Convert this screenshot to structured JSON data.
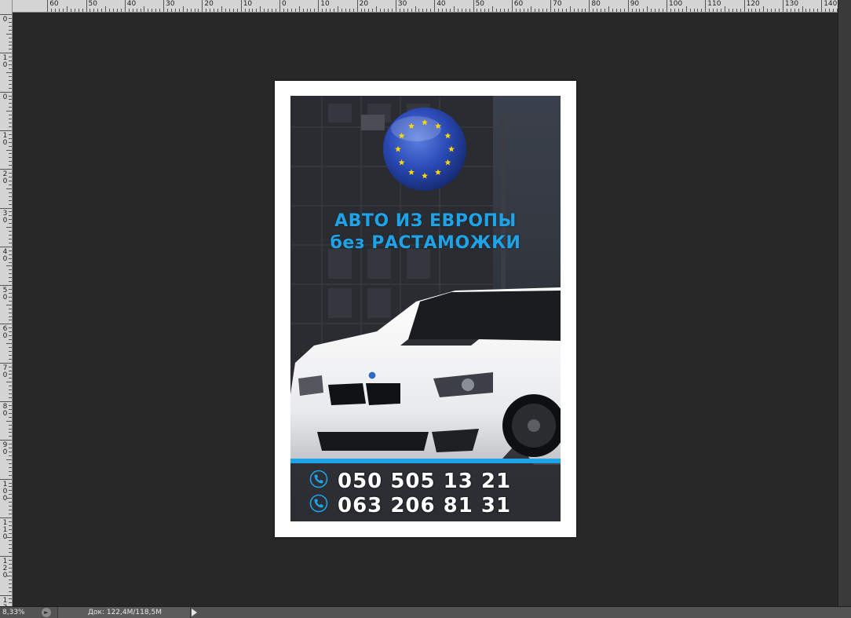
{
  "ruler": {
    "top_labels": [
      "0",
      "60",
      "50",
      "40",
      "30",
      "20",
      "10",
      "0",
      "10",
      "20",
      "30",
      "40",
      "50",
      "60",
      "70",
      "80",
      "90",
      "100",
      "110",
      "120",
      "130",
      "140"
    ],
    "left_labels": [
      "0",
      "10",
      "0",
      "10",
      "20",
      "30",
      "40",
      "50",
      "60",
      "70",
      "80",
      "90",
      "100",
      "110",
      "120",
      "130"
    ]
  },
  "document": {
    "headline_line1": "АВТО ИЗ ЕВРОПЫ",
    "headline_line2": "без РАСТАМОЖКИ",
    "phone_1": "050 505 13 21",
    "phone_2": "063 206 81 31",
    "accent_color": "#1ea3e8",
    "icons": [
      "eu-flag-badge-icon",
      "phone-icon"
    ]
  },
  "statusbar": {
    "zoom": "8,33%",
    "doc_info": "Док: 122,4M/118,5M"
  }
}
